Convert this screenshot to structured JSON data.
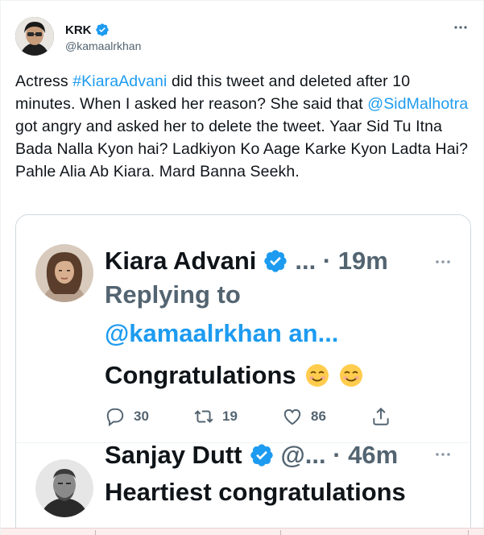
{
  "author": {
    "name": "KRK",
    "handle": "@kamaalrkhan"
  },
  "tweet": {
    "segments": {
      "s1": "Actress ",
      "hashtag": "#KiaraAdvani",
      "s2": " did this tweet and deleted after 10 minutes. When I asked her reason? She said that ",
      "mention": "@SidMalhotra",
      "s3": " got angry and asked her to delete the tweet. Yaar Sid Tu Itna Bada Nalla Kyon hai? Ladkiyon Ko Aage Karke Kyon Ladta Hai? Pahle Alia Ab Kiara. Mard Banna Seekh."
    }
  },
  "quoted": [
    {
      "name": "Kiara Advani",
      "meta": "... · 19m",
      "replying_to": "Replying to",
      "replying_link": "@kamaalrkhan an...",
      "text": "Congratulations",
      "emoji": [
        "smiling-face-emoji",
        "smiling-face-emoji"
      ],
      "replies": "30",
      "retweets": "19",
      "likes": "86"
    },
    {
      "name": "Sanjay Dutt",
      "meta": "@... · 46m",
      "text": "Heartiest congratulations"
    }
  ],
  "colors": {
    "accent": "#1d9bf0",
    "text": "#0f1419",
    "muted": "#536471",
    "border": "#cfd9de"
  },
  "icons": [
    "verified-badge-icon",
    "more-icon",
    "reply-icon",
    "retweet-icon",
    "like-icon",
    "share-icon"
  ]
}
